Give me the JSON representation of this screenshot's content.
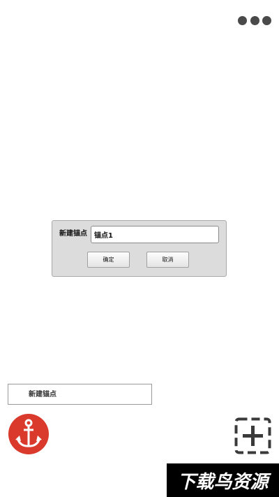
{
  "header": {
    "more_icon": "more-dots-icon"
  },
  "dialog": {
    "label": "新建锚点",
    "input_value": "锚点1",
    "ok_label": "确定",
    "cancel_label": "取消"
  },
  "new_anchor": {
    "label": "新建锚点"
  },
  "controls": {
    "anchor_icon": "anchor-icon",
    "add_icon": "dashed-plus-icon",
    "anchor_color": "#d93a2b"
  },
  "watermark": {
    "text": "下载鸟资源"
  }
}
